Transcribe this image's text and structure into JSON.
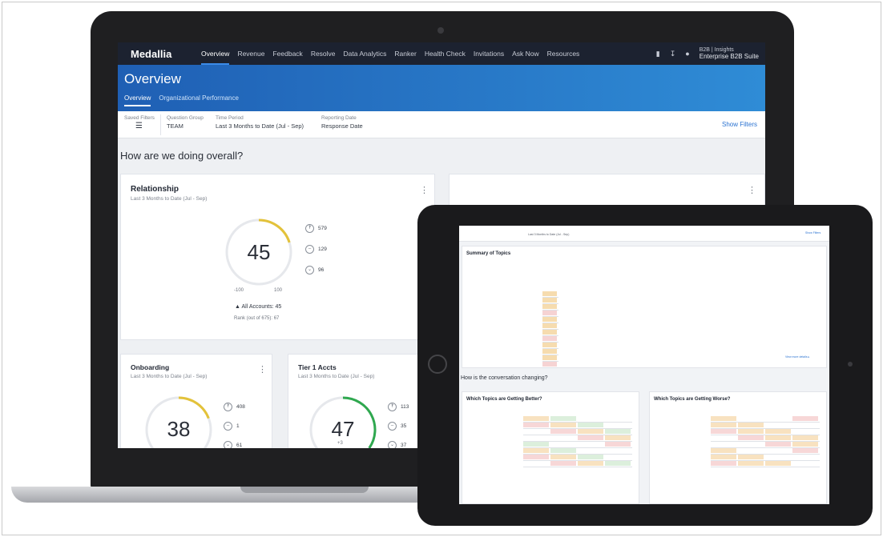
{
  "app": {
    "brand": "Medallia",
    "nav": [
      "Overview",
      "Revenue",
      "Feedback",
      "Resolve",
      "Data Analytics",
      "Ranker",
      "Health Check",
      "Invitations",
      "Ask Now",
      "Resources"
    ],
    "org_line1": "B2B | Insights",
    "org_line2": "Enterprise B2B Suite"
  },
  "icons": [
    "bookmark-icon",
    "download-icon",
    "user-icon",
    "filter-icon",
    "kebab-icon",
    "smile-icon",
    "neutral-icon",
    "frown-icon"
  ],
  "page": {
    "title": "Overview",
    "tabs": [
      "Overview",
      "Organizational Performance"
    ]
  },
  "filters": {
    "saved_label": "Saved Filters",
    "question_group_label": "Question Group",
    "question_group_value": "TEAM",
    "time_period_label": "Time Period",
    "time_period_value": "Last 3 Months to Date (Jul - Sep)",
    "reporting_date_label": "Reporting Date",
    "reporting_date_value": "Response Date",
    "show_filters": "Show Filters"
  },
  "section_title": "How are we doing overall?",
  "relationship": {
    "title": "Relationship",
    "subtitle": "Last 3 Months to Date (Jul - Sep)",
    "score": "45",
    "score_value": 45,
    "min": "-100",
    "max": "100",
    "promoters": "579",
    "passives": "129",
    "detractors": "96",
    "accounts": "▲ All Accounts: 45",
    "rank": "Rank (out of 675): 67"
  },
  "onboarding": {
    "title": "Onboarding",
    "subtitle": "Last 3 Months to Date (Jul - Sep)",
    "score": "38",
    "score_value": 38,
    "promoters": "408",
    "passives": "1",
    "detractors": "61"
  },
  "tier1": {
    "title": "Tier 1 Accts",
    "subtitle": "Last 3 Months to Date (Jul - Sep)",
    "score": "47",
    "score_value": 47,
    "delta": "+3",
    "promoters": "113",
    "passives": "35",
    "detractors": "37"
  },
  "tablet": {
    "filter_line": "Last 3 Months to Date (Jul - Sep)",
    "show_filters": "Show Filters",
    "summary_title": "Summary of Topics",
    "section_title": "How is the conversation changing?",
    "better_title": "Which Topics are Getting Better?",
    "worse_title": "Which Topics are Getting Worse?",
    "view_more": "View more details ▸"
  },
  "colors": {
    "nav_bg": "#1c2230",
    "hero_start": "#1f5fb4",
    "hero_end": "#2f8cd6",
    "gauge_yellow": "#e3c23a",
    "gauge_green": "#2fa84f",
    "link": "#2b73d1"
  }
}
